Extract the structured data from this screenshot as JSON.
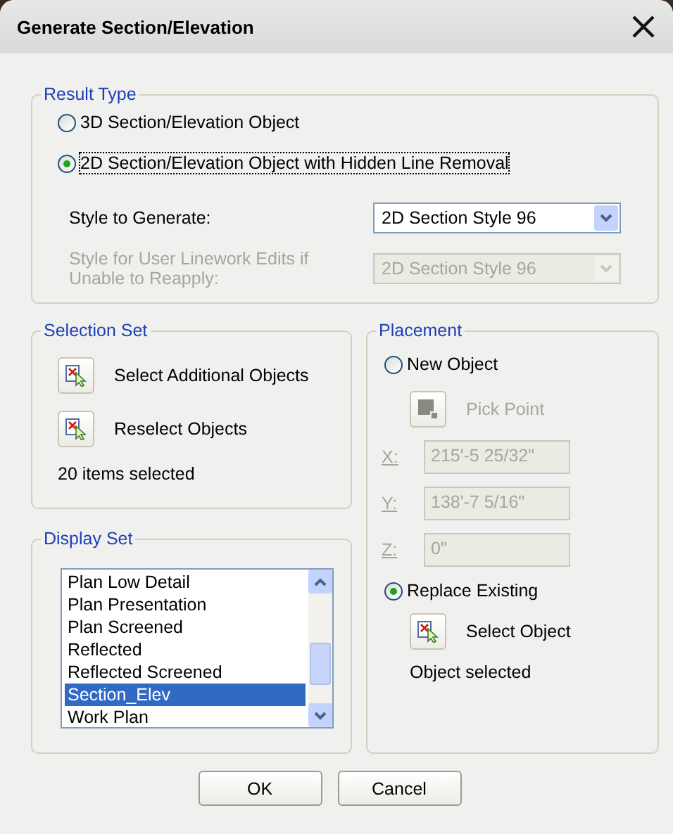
{
  "window": {
    "title": "Generate Section/Elevation"
  },
  "result_type": {
    "legend": "Result Type",
    "options": [
      {
        "label": "3D Section/Elevation Object",
        "selected": false,
        "focused": false
      },
      {
        "label": "2D Section/Elevation Object with Hidden Line Removal",
        "selected": true,
        "focused": true
      }
    ],
    "fields": [
      {
        "label": "Style to Generate:",
        "value": "2D Section Style 96",
        "disabled": false
      },
      {
        "label": "Style for User Linework Edits if Unable to Reapply:",
        "value": "2D Section Style 96",
        "disabled": true
      }
    ]
  },
  "selection_set": {
    "legend": "Selection Set",
    "actions": [
      {
        "label": "Select Additional Objects"
      },
      {
        "label": "Reselect Objects"
      }
    ],
    "status": "20 items selected"
  },
  "display_set": {
    "legend": "Display Set",
    "items": [
      {
        "label": "Plan Low Detail",
        "selected": false
      },
      {
        "label": "Plan Presentation",
        "selected": false
      },
      {
        "label": "Plan Screened",
        "selected": false
      },
      {
        "label": "Reflected",
        "selected": false
      },
      {
        "label": "Reflected Screened",
        "selected": false
      },
      {
        "label": "Section_Elev",
        "selected": true
      },
      {
        "label": "Work Plan",
        "selected": false
      }
    ]
  },
  "placement": {
    "legend": "Placement",
    "new_object": {
      "label": "New Object",
      "selected": false,
      "focused": false
    },
    "pick_point": {
      "label": "Pick Point",
      "disabled": true
    },
    "coordinates": [
      {
        "axis": "X:",
        "value": "215'-5 25/32\"",
        "disabled": true
      },
      {
        "axis": "Y:",
        "value": "138'-7 5/16\"",
        "disabled": true
      },
      {
        "axis": "Z:",
        "value": "0\"",
        "disabled": true
      }
    ],
    "replace_existing": {
      "label": "Replace Existing",
      "selected": true,
      "focused": false
    },
    "select_object": {
      "label": "Select Object"
    },
    "status": "Object selected"
  },
  "buttons": [
    {
      "label": "OK"
    },
    {
      "label": "Cancel"
    }
  ]
}
